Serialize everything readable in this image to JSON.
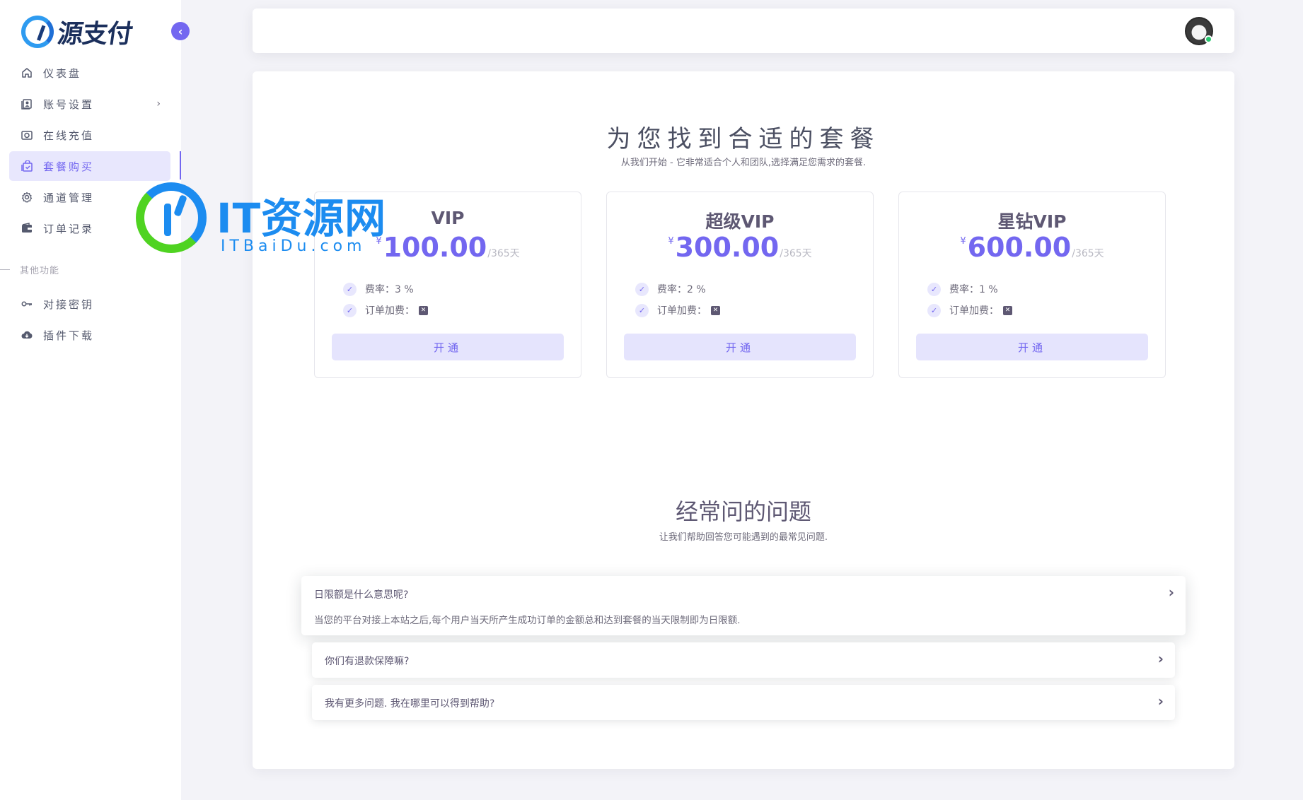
{
  "brand": {
    "name": "源支付"
  },
  "sidebar": {
    "items": [
      {
        "label": "仪表盘",
        "icon": "home-icon"
      },
      {
        "label": "账号设置",
        "icon": "user-card-icon",
        "has_children": true
      },
      {
        "label": "在线充值",
        "icon": "camera-icon"
      },
      {
        "label": "套餐购买",
        "icon": "shopping-bag-icon",
        "active": true
      },
      {
        "label": "通道管理",
        "icon": "gear-icon"
      },
      {
        "label": "订单记录",
        "icon": "wallet-icon"
      }
    ],
    "section_label": "其他功能",
    "items2": [
      {
        "label": "对接密钥",
        "icon": "key-icon"
      },
      {
        "label": "插件下载",
        "icon": "cloud-download-icon"
      }
    ]
  },
  "hero": {
    "title": "为您找到合适的套餐",
    "subtitle": "从我们开始 - 它非常适合个人和团队,选择满足您需求的套餐."
  },
  "plans": [
    {
      "name": "VIP",
      "currency": "¥",
      "price": "100.00",
      "period": "/365天",
      "rate": "费率：3 %",
      "fee_label": "订单加费：",
      "button": "开通"
    },
    {
      "name": "超级VIP",
      "currency": "¥",
      "price": "300.00",
      "period": "/365天",
      "rate": "费率：2 %",
      "fee_label": "订单加费：",
      "button": "开通"
    },
    {
      "name": "星钻VIP",
      "currency": "¥",
      "price": "600.00",
      "period": "/365天",
      "rate": "费率：1 %",
      "fee_label": "订单加费：",
      "button": "开通"
    }
  ],
  "faq": {
    "title": "经常问的问题",
    "subtitle": "让我们帮助回答您可能遇到的最常见问题.",
    "items": [
      {
        "q": "日限额是什么意思呢?",
        "a": "当您的平台对接上本站之后,每个用户当天所产生成功订单的金额总和达到套餐的当天限制即为日限额.",
        "open": true
      },
      {
        "q": "你们有退款保障嘛?"
      },
      {
        "q": "我有更多问题. 我在哪里可以得到帮助?"
      }
    ]
  },
  "watermark": {
    "title": "IT资源网",
    "subtitle": "ITBaiDu.com"
  },
  "colors": {
    "accent": "#7367f0",
    "accent_light": "#e8e7fd",
    "online": "#28c76f",
    "watermark_blue": "#1c8cf0",
    "watermark_green": "#4fd321"
  }
}
